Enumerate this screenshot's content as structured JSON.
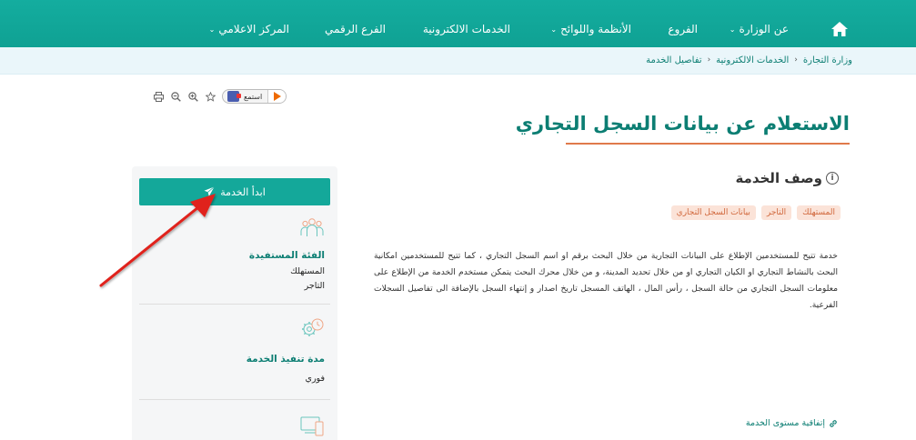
{
  "nav": {
    "items": [
      {
        "label": "عن الوزارة",
        "has_dropdown": true
      },
      {
        "label": "الفروع",
        "has_dropdown": false
      },
      {
        "label": "الأنظمة واللوائح",
        "has_dropdown": true
      },
      {
        "label": "الخدمات الالكترونية",
        "has_dropdown": false
      },
      {
        "label": "الفرع الرقمي",
        "has_dropdown": false
      },
      {
        "label": "المركز الاعلامي",
        "has_dropdown": true
      }
    ],
    "home_icon": "home-icon",
    "color": "#14a89a"
  },
  "breadcrumb": {
    "items": [
      "وزارة التجارة",
      "الخدمات الالكترونية",
      "تفاصيل الخدمة"
    ]
  },
  "toolbar": {
    "listen_label": "استمع"
  },
  "page": {
    "title": "الاستعلام عن بيانات السجل التجاري",
    "accent": "#e07a4a"
  },
  "description": {
    "heading": "وصف الخدمة",
    "tags": [
      "المستهلك",
      "التاجر",
      "بيانات السجل التجاري"
    ],
    "text": "خدمة تتيح للمستخدمين الإطلاع على البيانات التجارية من خلال البحث برقم او اسم السجل التجاري ، كما تتيح للمستخدمين امكانية البحث بالنشاط التجاري او الكيان التجاري او من خلال تحديد المدينة، و من خلال محرك البحث يتمكن مستخدم  الخدمة من الإطلاع على معلومات السجل التجاري من حالة السجل ، رأس المال ، الهاتف المسجل تاريخ اصدار و إنتهاء السجل بالإضافة الى تفاصيل السجلات الفرعية."
  },
  "sla": {
    "label": "إتفاقية مستوى الخدمة"
  },
  "sidebar": {
    "start_label": "ابدأ الخدمة",
    "beneficiary": {
      "label": "الفئة المستفيدة",
      "values": [
        "المستهلك",
        "التاجر"
      ]
    },
    "duration": {
      "label": "مدة تنفيذ الخدمة",
      "value": "فوري"
    }
  }
}
